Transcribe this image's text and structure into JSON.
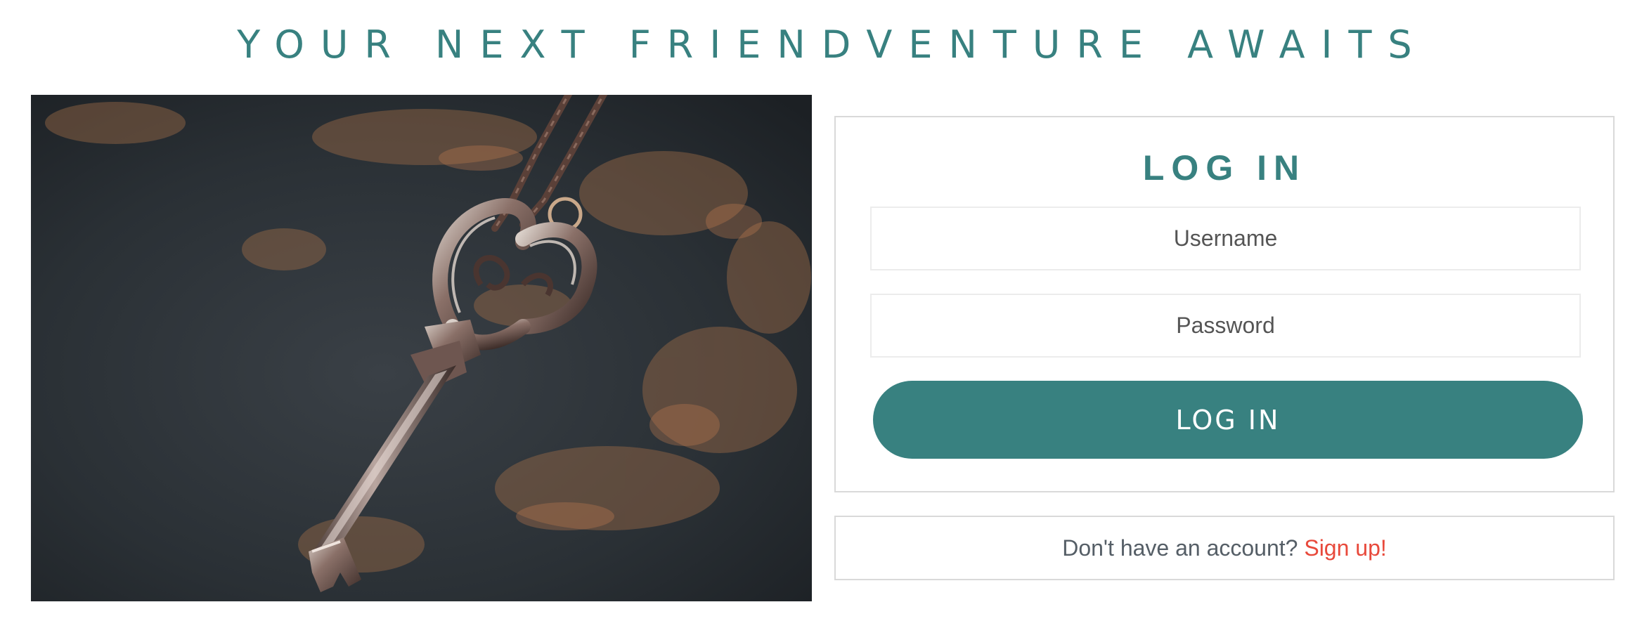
{
  "header": {
    "title": "YOUR NEXT FRIENDVENTURE AWAITS"
  },
  "hero_image": {
    "description_icon": "key-on-chain-photo"
  },
  "login": {
    "heading": "LOG IN",
    "username_placeholder": "Username",
    "password_placeholder": "Password",
    "submit_label": "LOG IN"
  },
  "signup": {
    "prompt": "Don't have an account? ",
    "link_label": "Sign up!"
  },
  "colors": {
    "brand_teal": "#388180",
    "link_red": "#e8493b",
    "muted_text": "#555e66",
    "border_gray": "#d9d9d9"
  }
}
